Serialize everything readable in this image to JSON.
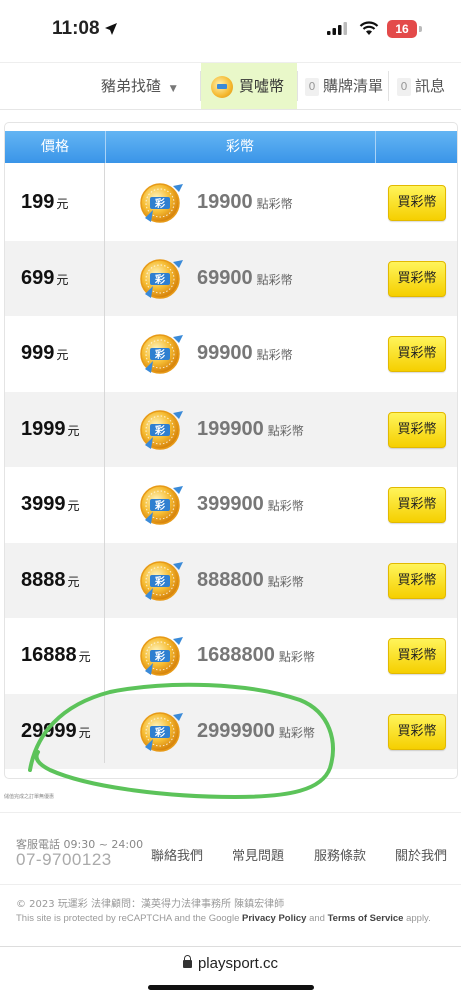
{
  "status_bar": {
    "time": "11:08",
    "battery": "16"
  },
  "nav": {
    "item1": "豬弟找碴",
    "item2": "買噓幣",
    "item3_count": "0",
    "item3": "購牌清單",
    "item4_count": "0",
    "item4": "訊息"
  },
  "table": {
    "header_price": "價格",
    "header_coin": "彩幣",
    "unit": "元",
    "points_label": "點彩幣",
    "buy_label": "買彩幣",
    "rows": [
      {
        "price": "199",
        "amount": "19900"
      },
      {
        "price": "699",
        "amount": "69900"
      },
      {
        "price": "999",
        "amount": "99900"
      },
      {
        "price": "1999",
        "amount": "199900"
      },
      {
        "price": "3999",
        "amount": "399900"
      },
      {
        "price": "8888",
        "amount": "888800"
      },
      {
        "price": "16888",
        "amount": "1688800"
      },
      {
        "price": "29999",
        "amount": "2999900"
      }
    ]
  },
  "note": "儲值完成之訂單無優惠",
  "footer": {
    "phone_label": "客服電話 09:30 ~ 24:00",
    "phone": "07-9700123",
    "links": [
      "聯絡我們",
      "常見問題",
      "服務條款",
      "關於我們"
    ],
    "copyright": "© 2023 玩運彩 法律顧問：漢英得力法律事務所 陳鎮宏律師",
    "recaptcha_pre": "This site is protected by reCAPTCHA and the Google ",
    "privacy": "Privacy Policy",
    "and": " and ",
    "terms": "Terms of Service",
    "apply": " apply."
  },
  "url": "playsport.cc",
  "colors": {
    "header_blue": "#3a95e8",
    "button_yellow": "#fde100",
    "annotation_green": "#5cc35a"
  }
}
